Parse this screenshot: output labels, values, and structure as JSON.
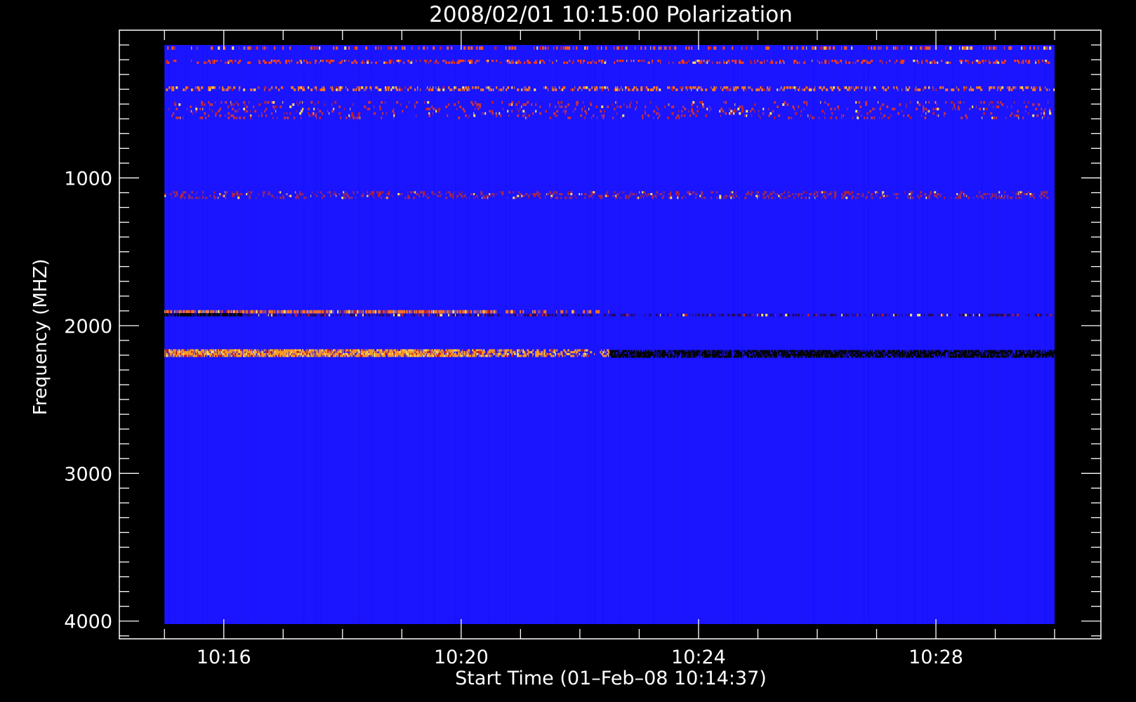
{
  "chart_data": {
    "type": "heatmap",
    "title": "2008/02/01 10:15:00 Polarization",
    "xlabel": "Start Time (01–Feb–08 10:14:37)",
    "ylabel": "Frequency (MHZ)",
    "x_major_ticks": [
      "10:16",
      "10:20",
      "10:24",
      "10:28"
    ],
    "x_major_tick_values_min": [
      16,
      20,
      24,
      28
    ],
    "x_data_range_min": [
      15,
      30
    ],
    "xlim_min": [
      14.24,
      30.78
    ],
    "y_major_ticks": [
      "1000",
      "2000",
      "3000",
      "4000"
    ],
    "y_major_tick_values": [
      1000,
      2000,
      3000,
      4000
    ],
    "ylim": [
      0,
      4120
    ],
    "y_inverted": true,
    "freq_range": [
      100,
      4020
    ],
    "background_color": "#1a14ff",
    "bands": [
      {
        "freq": [
          110,
          130
        ],
        "t": [
          15,
          30
        ],
        "color": "#ff5a14",
        "density": 0.3,
        "profile": "flat"
      },
      {
        "freq": [
          200,
          225
        ],
        "t": [
          15,
          30
        ],
        "color": "#ff4010",
        "density": 0.3,
        "profile": "flat"
      },
      {
        "freq": [
          380,
          410
        ],
        "t": [
          15,
          30
        ],
        "color": "#ff7a1e",
        "density": 0.35,
        "profile": "flat"
      },
      {
        "freq": [
          480,
          600
        ],
        "t": [
          15,
          30
        ],
        "color": "#c83242",
        "density": 0.12,
        "profile": "flat"
      },
      {
        "freq": [
          1090,
          1140
        ],
        "t": [
          15,
          30
        ],
        "color": "#a02a58",
        "density": 0.25,
        "profile": "flat"
      },
      {
        "freq": [
          1895,
          1915
        ],
        "t": [
          15,
          22.5
        ],
        "color": "#ff7020",
        "density": 0.9,
        "profile": "fade"
      },
      {
        "freq": [
          1915,
          1935
        ],
        "t": [
          15,
          16.3
        ],
        "color": "#000000",
        "density": 1.0,
        "profile": "flat"
      },
      {
        "freq": [
          1920,
          1935
        ],
        "t": [
          16.3,
          30
        ],
        "color": "#250a60",
        "density": 0.5,
        "profile": "flat"
      },
      {
        "freq": [
          2160,
          2210
        ],
        "t": [
          15,
          22.5
        ],
        "color": "#ff9a20",
        "density": 0.95,
        "profile": "fade"
      },
      {
        "freq": [
          2165,
          2215
        ],
        "t": [
          22.5,
          30
        ],
        "color": "#050505",
        "density": 0.9,
        "profile": "flat"
      }
    ]
  }
}
